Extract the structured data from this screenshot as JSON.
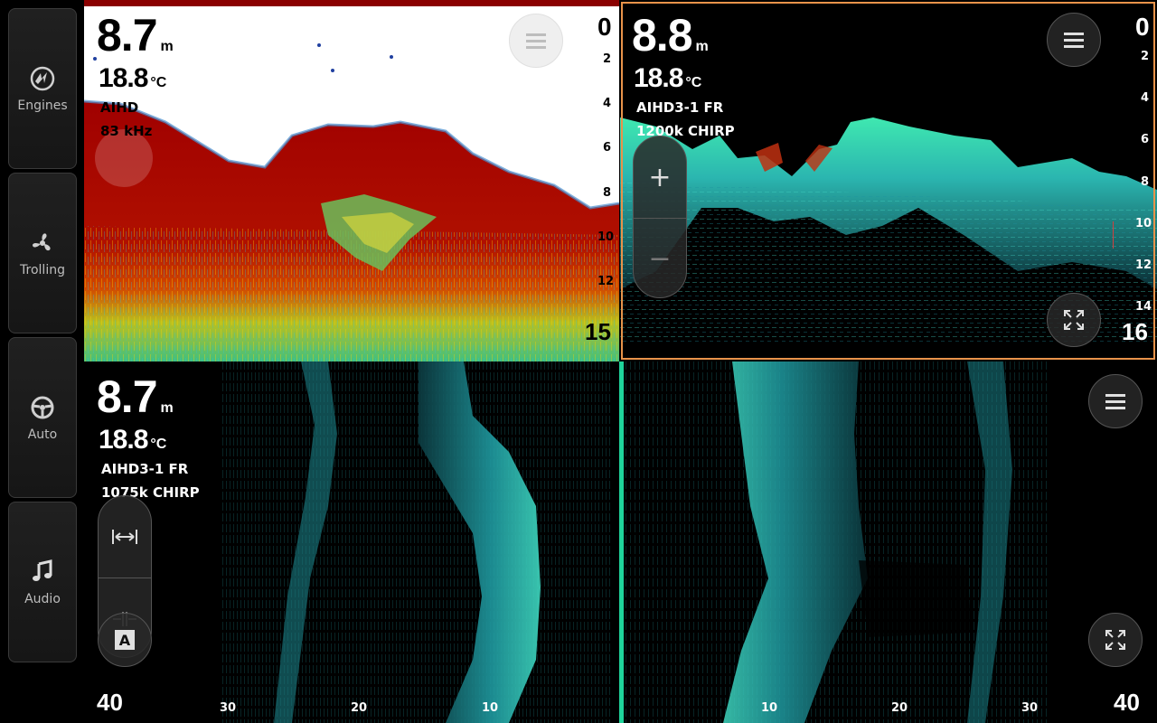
{
  "sidebar": {
    "items": [
      {
        "label": "Engines",
        "icon": "mercury-logo-icon"
      },
      {
        "label": "Trolling",
        "icon": "propeller-icon"
      },
      {
        "label": "Auto",
        "icon": "steering-wheel-icon"
      },
      {
        "label": "Audio",
        "icon": "music-note-icon"
      }
    ]
  },
  "panel_traditional": {
    "depth": "8.7",
    "depth_unit": "m",
    "temp": "18.8",
    "temp_unit": "°C",
    "transducer": "AIHD",
    "frequency": "83 kHz",
    "scale_labels": [
      "0",
      "2",
      "4",
      "6",
      "8",
      "10",
      "12",
      "15"
    ],
    "menu_icon": "menu-icon"
  },
  "panel_downscan": {
    "depth": "8.8",
    "depth_unit": "m",
    "temp": "18.8",
    "temp_unit": "°C",
    "transducer": "AIHD3-1 FR",
    "frequency": "1200k CHIRP",
    "scale_labels": [
      "0",
      "2",
      "4",
      "6",
      "8",
      "10",
      "12",
      "14",
      "16"
    ],
    "zoom_in": "+",
    "zoom_out": "−",
    "menu_icon": "menu-icon",
    "expand_icon": "expand-icon"
  },
  "panel_sidescan_left": {
    "depth": "8.7",
    "depth_unit": "m",
    "temp": "18.8",
    "temp_unit": "°C",
    "transducer": "AIHD3-1 FR",
    "frequency": "1075k CHIRP",
    "range_labels": [
      "40",
      "30",
      "20",
      "10"
    ],
    "range_icon": "range-arrows-icon",
    "auto_label": "A"
  },
  "panel_sidescan_right": {
    "range_labels": [
      "10",
      "20",
      "30",
      "40"
    ],
    "menu_icon": "menu-icon",
    "expand_icon": "expand-icon"
  },
  "colors": {
    "active_border": "#e8934a",
    "divider": "#1fd39a",
    "sonar_cyan": "#2ed9c0",
    "sonar_red": "#a00000"
  }
}
